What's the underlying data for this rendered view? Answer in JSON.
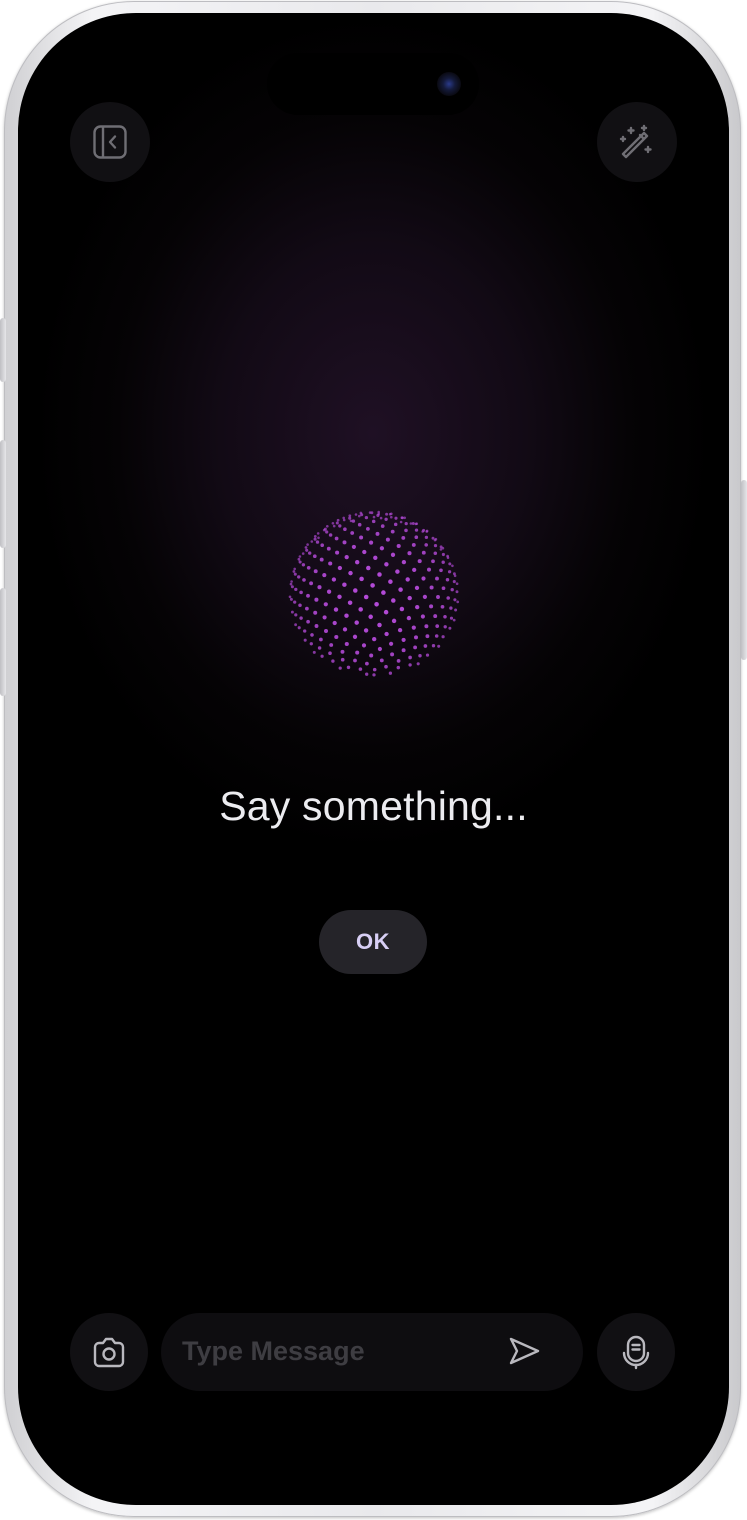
{
  "voice_prompt": {
    "text": "Say something...",
    "ok_label": "OK"
  },
  "top_bar": {
    "left_icon": "sidebar-collapse-icon",
    "right_icon": "magic-wand-icon"
  },
  "composer": {
    "camera_icon": "camera-icon",
    "placeholder": "Type Message",
    "value": "",
    "send_icon": "send-icon",
    "mic_icon": "microphone-icon"
  },
  "colors": {
    "orb_accent": "#b44ad8",
    "ok_text": "#d8cff5",
    "background": "#000000"
  }
}
